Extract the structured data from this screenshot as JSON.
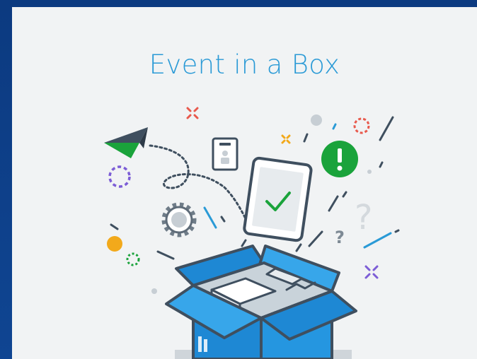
{
  "card": {
    "title": "Event in a Box"
  },
  "illustration": {
    "icons": [
      "paper-plane-icon",
      "badge-icon",
      "tablet-icon",
      "checkmark-icon",
      "exclamation-icon",
      "question-mark-icon",
      "gear-icon",
      "open-box-icon"
    ],
    "colors": {
      "title": "#2a9ad6",
      "box_blue": "#1e88d4",
      "box_light": "#37a6ea",
      "outline": "#3f4f5f",
      "green": "#1aa33b",
      "red": "#e8594c",
      "yellow": "#f2a91b",
      "purple": "#7c5dd6",
      "grey": "#c7ced4",
      "background": "#f1f3f4",
      "frame": "#0e3f86"
    }
  }
}
